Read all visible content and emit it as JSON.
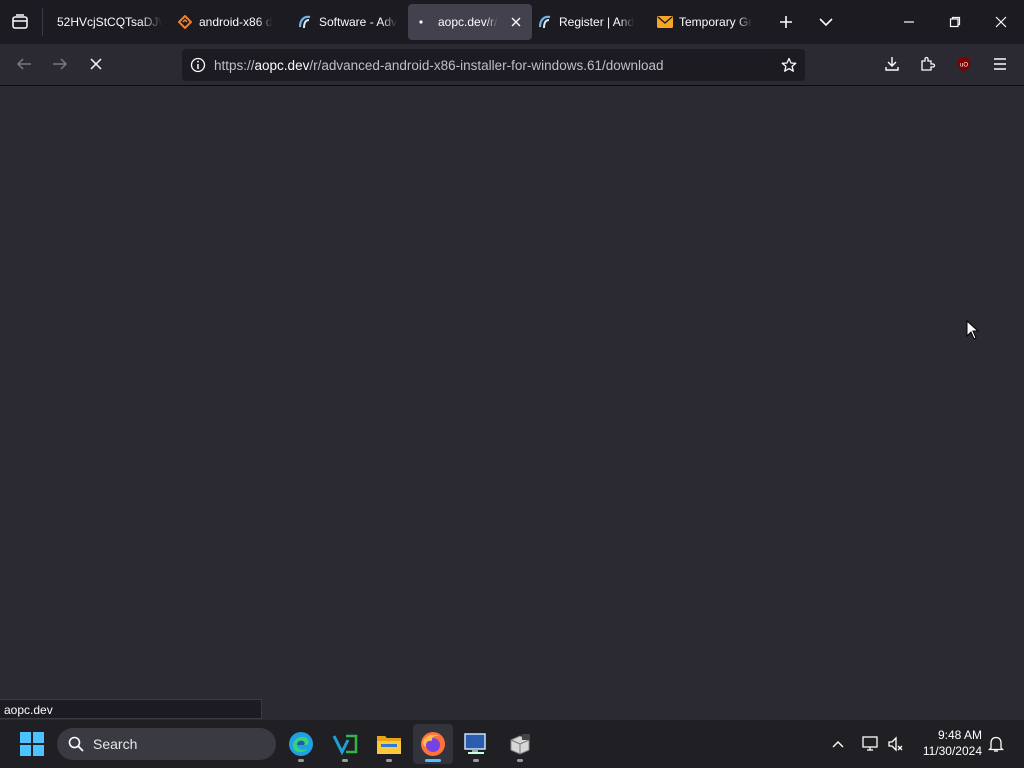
{
  "tabs": [
    {
      "label": "52HVcjStCQTsaDJ\\",
      "active": false,
      "icon": "none"
    },
    {
      "label": "android-x86 d",
      "active": false,
      "icon": "diamond-icon"
    },
    {
      "label": "Software - Adv",
      "active": false,
      "icon": "aopc-logo-icon"
    },
    {
      "label": "aopc.dev/r/a",
      "active": true,
      "icon": "loading-dot-icon"
    },
    {
      "label": "Register | And",
      "active": false,
      "icon": "aopc-logo-icon"
    },
    {
      "label": "Temporary Gr",
      "active": false,
      "icon": "mail-icon"
    }
  ],
  "url": {
    "scheme": "https://",
    "host": "aopc.dev",
    "path": "/r/advanced-android-x86-installer-for-windows.61/download"
  },
  "status_text": "aopc.dev",
  "taskbar": {
    "search_placeholder": "Search",
    "time": "9:48 AM",
    "date": "11/30/2024"
  },
  "colors": {
    "accent": "#4cc2ff",
    "page_bg": "#2b2a33",
    "tab_bg": "#1c1b22"
  }
}
